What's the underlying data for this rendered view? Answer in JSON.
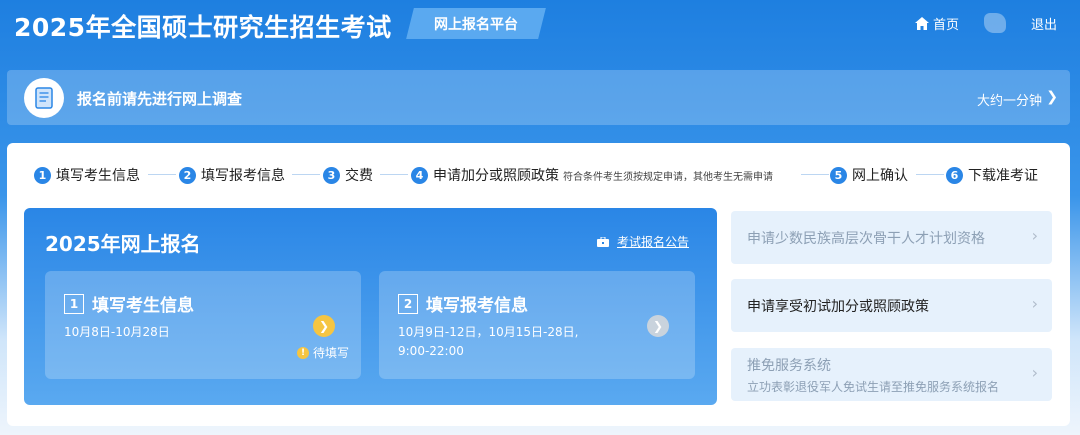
{
  "header": {
    "title": "2025年全国硕士研究生招生考试",
    "platform": "网上报名平台",
    "home": "首页",
    "logout": "退出"
  },
  "survey": {
    "text": "报名前请先进行网上调查",
    "duration": "大约一分钟"
  },
  "steps": [
    {
      "num": "1",
      "label": "填写考生信息"
    },
    {
      "num": "2",
      "label": "填写报考信息"
    },
    {
      "num": "3",
      "label": "交费"
    },
    {
      "num": "4",
      "label": "申请加分或照顾政策",
      "note": "符合条件考生须按规定申请，其他考生无需申请"
    },
    {
      "num": "5",
      "label": "网上确认"
    },
    {
      "num": "6",
      "label": "下载准考证"
    }
  ],
  "registration": {
    "title": "2025年网上报名",
    "notice": "考试报名公告",
    "cards": [
      {
        "num": "1",
        "title": "填写考生信息",
        "date": "10月8日-10月28日",
        "status": "待填写"
      },
      {
        "num": "2",
        "title": "填写报考信息",
        "date_line1": "10月9日-12日，10月15日-28日,",
        "date_line2": "9:00-22:00"
      }
    ]
  },
  "side": [
    {
      "label": "申请少数民族高层次骨干人才计划资格"
    },
    {
      "label": "申请享受初试加分或照顾政策"
    },
    {
      "label": "推免服务系统",
      "sub": "立功表彰退役军人免试生请至推免服务系统报名"
    }
  ],
  "colors": {
    "primary": "#2a86e6",
    "accent_yellow": "#f5c542",
    "side_bg": "#e6f1fc"
  }
}
